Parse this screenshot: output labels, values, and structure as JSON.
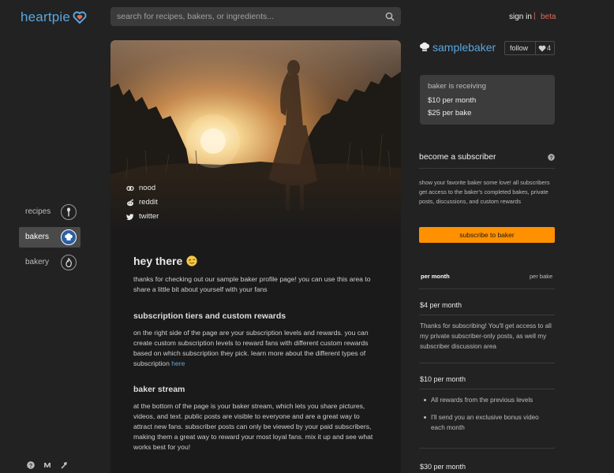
{
  "header": {
    "logo_text": "heartpie",
    "search_placeholder": "search for recipes, bakers, or ingredients...",
    "signin_label": "sign in",
    "separator": "|",
    "beta_label": "beta"
  },
  "nav": {
    "items": [
      {
        "label": "recipes",
        "icon": "spoon-icon",
        "active": false
      },
      {
        "label": "bakers",
        "icon": "chef-hat-icon",
        "active": true
      },
      {
        "label": "bakery",
        "icon": "flame-icon",
        "active": false
      }
    ],
    "bottom_icons": [
      "help-icon",
      "medium-icon",
      "tools-icon"
    ]
  },
  "profile": {
    "social_links": [
      {
        "label": "nood",
        "icon": "nood-icon"
      },
      {
        "label": "reddit",
        "icon": "reddit-icon"
      },
      {
        "label": "twitter",
        "icon": "twitter-icon"
      }
    ],
    "greeting": "hey there",
    "greeting_emoji": "winking-tongue-emoji",
    "intro": "thanks for checking out our sample baker profile page! you can use this area to share a little bit about yourself with your fans",
    "section1_title": "subscription tiers and custom rewards",
    "section1_text": "on the right side of the page are your subscription levels and rewards. you can create custom subscription levels to reward fans with different custom rewards based on which subscription they pick. learn more about the different types of subscription",
    "section1_link": "here",
    "section2_title": "baker stream",
    "section2_text": "at the bottom of the page is your baker stream, which lets you share pictures, videos, and text. public posts are visible to everyone and are a great way to attract new fans. subscriber posts can only be viewed by your paid subscribers, making them a great way to reward your most loyal fans. mix it up and see what works best for you!"
  },
  "sidebar": {
    "baker_name": "samplebaker",
    "follow_label": "follow",
    "heart_count": "4",
    "receiving_title": "baker is receiving",
    "receiving_month": "$10 per month",
    "receiving_bake": "$25 per bake",
    "subscriber_title": "become a subscriber",
    "subscriber_desc": "show your favorite baker some love! all subscribers get access to the baker's completed bakes, private posts, discussions, and custom rewards",
    "subscribe_button": "subscribe to baker",
    "tab_month": "per month",
    "tab_bake": "per bake",
    "tiers": [
      {
        "name": "$4 per month",
        "text": "Thanks for subscribing! You'll get access to all my private subscriber-only posts, as well my subscriber discussion area"
      },
      {
        "name": "$10 per month",
        "bullets": [
          "All rewards from the previous levels",
          "I'll send you an exclusive bonus video each month"
        ]
      },
      {
        "name": "$30 per month"
      }
    ]
  },
  "colors": {
    "accent_blue": "#5aa6e0",
    "beta_red": "#e06b5a",
    "subscribe_orange": "#ff9100",
    "background": "#222222"
  }
}
